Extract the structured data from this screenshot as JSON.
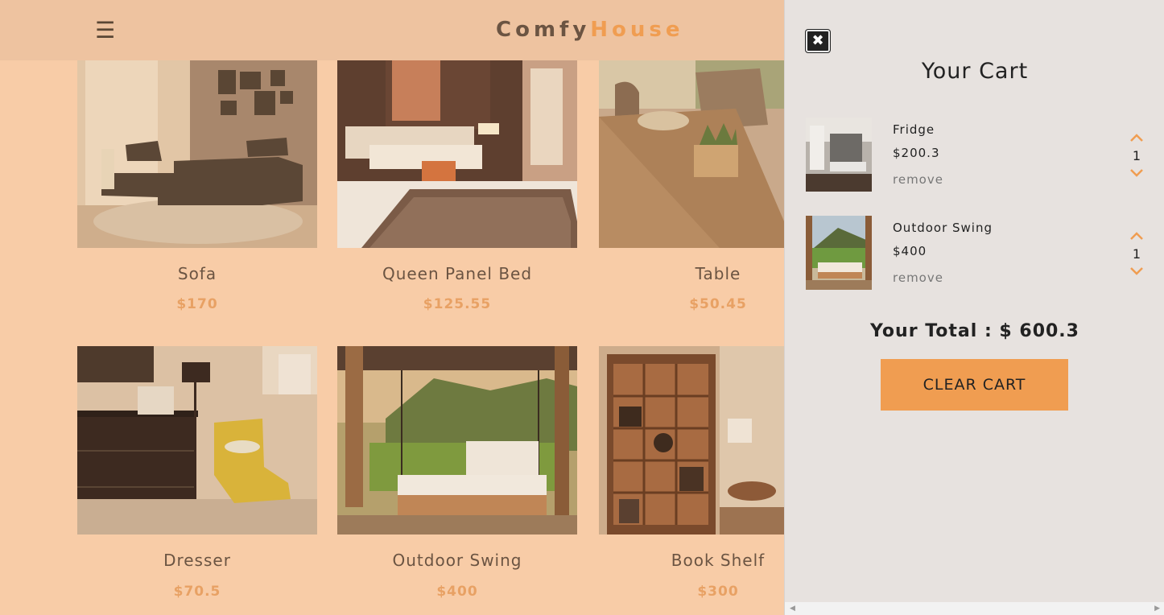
{
  "navbar": {
    "menu_icon": "☰",
    "brand_part1": "Comfy",
    "brand_part2": "House"
  },
  "products": [
    {
      "name": "Sofa",
      "price": "$170"
    },
    {
      "name": "Queen Panel Bed",
      "price": "$125.55"
    },
    {
      "name": "Table",
      "price": "$50.45"
    },
    {
      "name": "Dresser",
      "price": "$70.5"
    },
    {
      "name": "Outdoor Swing",
      "price": "$400"
    },
    {
      "name": "Book Shelf",
      "price": "$300"
    }
  ],
  "cart": {
    "close_icon": "✖",
    "title": "Your Cart",
    "items": [
      {
        "name": "Fridge",
        "price": "$200.3",
        "remove": "remove",
        "qty": "1"
      },
      {
        "name": "Outdoor Swing",
        "price": "$400",
        "remove": "remove",
        "qty": "1"
      }
    ],
    "total_label": "Your Total : $ 600.3",
    "clear_label": "CLEAR CART"
  },
  "colors": {
    "overlay": "#f8cca7",
    "navbar": "#eec3a0",
    "accent": "#f09d51",
    "cart_bg": "#e7e2df"
  },
  "icons": [
    "menu-icon",
    "close-icon",
    "chevron-up-icon",
    "chevron-down-icon"
  ]
}
